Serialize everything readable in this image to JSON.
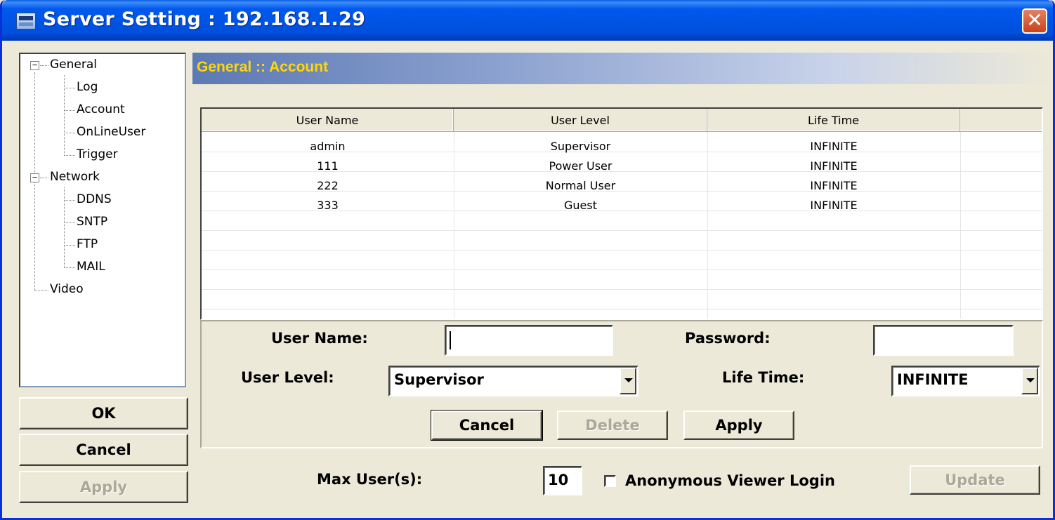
{
  "window": {
    "title": "Server Setting : 192.168.1.29",
    "close_glyph": "✕"
  },
  "tree": {
    "groups": [
      {
        "label": "General",
        "expander": "−",
        "children": [
          "Log",
          "Account",
          "OnLineUser",
          "Trigger"
        ]
      },
      {
        "label": "Network",
        "expander": "−",
        "children": [
          "DDNS",
          "SNTP",
          "FTP",
          "MAIL"
        ]
      }
    ],
    "leaf": "Video"
  },
  "left_buttons": {
    "ok": "OK",
    "cancel": "Cancel",
    "apply": "Apply"
  },
  "section": {
    "title": "General :: Account"
  },
  "table": {
    "columns": [
      "User Name",
      "User Level",
      "Life Time",
      ""
    ],
    "rows": [
      [
        "admin",
        "Supervisor",
        "INFINITE"
      ],
      [
        "111",
        "Power User",
        "INFINITE"
      ],
      [
        "222",
        "Normal User",
        "INFINITE"
      ],
      [
        "333",
        "Guest",
        "INFINITE"
      ]
    ]
  },
  "form": {
    "user_name_label": "User Name:",
    "user_name_value": "",
    "password_label": "Password:",
    "password_value": "",
    "user_level_label": "User Level:",
    "user_level_value": "Supervisor",
    "life_time_label": "Life Time:",
    "life_time_value": "INFINITE",
    "cancel": "Cancel",
    "delete": "Delete",
    "apply": "Apply"
  },
  "footer": {
    "max_users_label": "Max User(s):",
    "max_users_value": "10",
    "anonymous_label": "Anonymous Viewer Login",
    "anonymous_checked": false,
    "update": "Update"
  }
}
